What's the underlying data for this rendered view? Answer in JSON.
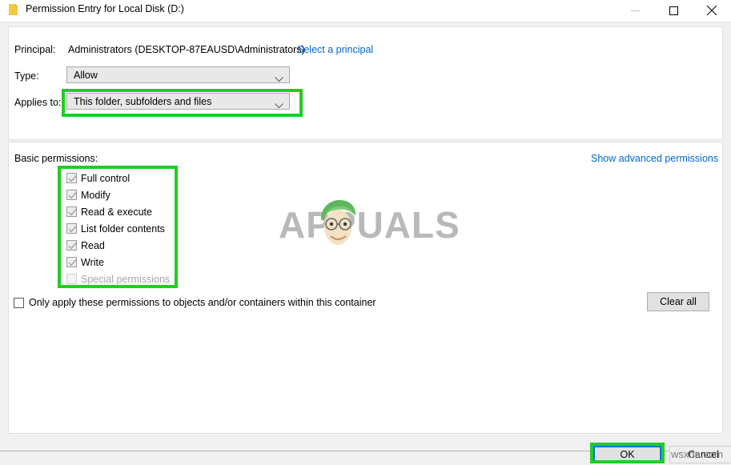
{
  "window": {
    "title": "Permission Entry for Local Disk (D:)",
    "icon": "folder-icon",
    "controls": {
      "minimize": "minimize-icon",
      "maximize": "maximize-icon",
      "close": "close-icon"
    }
  },
  "principal": {
    "label": "Principal:",
    "value": "Administrators (DESKTOP-87EAUSD\\Administrators)",
    "link": "Select a principal"
  },
  "type": {
    "label": "Type:",
    "value": "Allow"
  },
  "applies_to": {
    "label": "Applies to:",
    "value": "This folder, subfolders and files"
  },
  "permissions": {
    "section_label": "Basic permissions:",
    "advanced_link": "Show advanced permissions",
    "items": [
      {
        "label": "Full control",
        "checked": true,
        "disabled": false
      },
      {
        "label": "Modify",
        "checked": true,
        "disabled": false
      },
      {
        "label": "Read & execute",
        "checked": true,
        "disabled": false
      },
      {
        "label": "List folder contents",
        "checked": true,
        "disabled": false
      },
      {
        "label": "Read",
        "checked": true,
        "disabled": false
      },
      {
        "label": "Write",
        "checked": true,
        "disabled": false
      },
      {
        "label": "Special permissions",
        "checked": false,
        "disabled": true
      }
    ]
  },
  "only_apply": {
    "label": "Only apply these permissions to objects and/or containers within this container",
    "checked": false
  },
  "buttons": {
    "clear_all": "Clear all",
    "ok": "OK",
    "cancel": "Cancel"
  },
  "watermark": {
    "text": "APPUALS",
    "corner": "wsxdn.com"
  },
  "colors": {
    "highlight": "#22cc22",
    "link": "#0066cc",
    "focus": "#0078d7",
    "watermark": "#b9b9b9"
  }
}
